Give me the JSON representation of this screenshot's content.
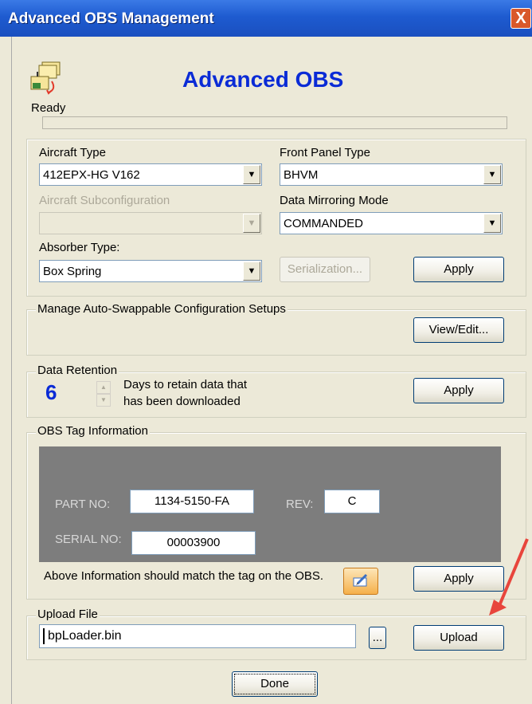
{
  "window": {
    "title": "Advanced OBS Management",
    "close_label": "X"
  },
  "header": {
    "title": "Advanced OBS",
    "status": "Ready",
    "progress": 0
  },
  "config": {
    "aircraft_type_label": "Aircraft Type",
    "aircraft_type_value": "412EPX-HG V162",
    "front_panel_label": "Front Panel Type",
    "front_panel_value": "BHVM",
    "subconfig_label": "Aircraft Subconfiguration",
    "subconfig_value": "",
    "mirroring_label": "Data Mirroring Mode",
    "mirroring_value": "COMMANDED",
    "absorber_label": "Absorber Type:",
    "absorber_value": "Box Spring",
    "serialization_label": "Serialization...",
    "apply_label": "Apply"
  },
  "swappable": {
    "title": "Manage Auto-Swappable Configuration Setups",
    "view_edit_label": "View/Edit..."
  },
  "retention": {
    "title": "Data Retention",
    "days": "6",
    "line1": "Days to retain data that",
    "line2": "has been downloaded",
    "apply_label": "Apply"
  },
  "tag": {
    "title": "OBS Tag Information",
    "part_label": "PART NO:",
    "part_value": "1134-5150-FA",
    "rev_label": "REV:",
    "rev_value": "C",
    "serial_label": "SERIAL NO:",
    "serial_value": "00003900",
    "note": "Above Information should match the tag on the OBS.",
    "apply_label": "Apply"
  },
  "upload": {
    "title": "Upload File",
    "file_value": "bpLoader.bin",
    "browse_label": "...",
    "upload_label": "Upload"
  },
  "footer": {
    "done_label": "Done"
  },
  "colors": {
    "title_bar": "#1e5bd0",
    "accent_blue": "#0a2bd6",
    "annotation_arrow": "#e8453c",
    "tag_panel": "#7d7d7d"
  },
  "icons": {
    "app": "folder-sync-icon",
    "edit": "edit-tag-icon",
    "close": "close-icon"
  }
}
